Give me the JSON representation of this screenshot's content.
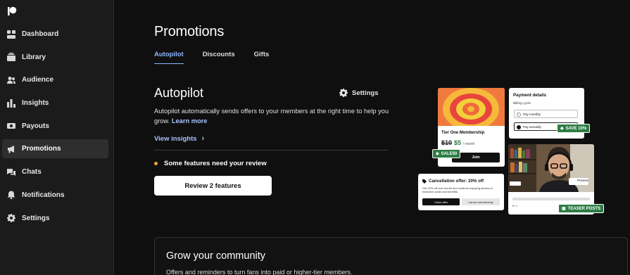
{
  "sidebar": {
    "logo_icon": "patreon-logo-icon",
    "items": [
      {
        "label": "Dashboard",
        "icon": "dashboard-icon"
      },
      {
        "label": "Library",
        "icon": "library-icon"
      },
      {
        "label": "Audience",
        "icon": "audience-icon"
      },
      {
        "label": "Insights",
        "icon": "insights-icon"
      },
      {
        "label": "Payouts",
        "icon": "payouts-icon"
      },
      {
        "label": "Promotions",
        "icon": "promotions-icon",
        "active": true
      },
      {
        "label": "Chats",
        "icon": "chats-icon"
      },
      {
        "label": "Notifications",
        "icon": "bell-icon"
      },
      {
        "label": "Settings",
        "icon": "gear-icon"
      }
    ]
  },
  "page": {
    "title": "Promotions",
    "tabs": [
      {
        "label": "Autopilot",
        "active": true
      },
      {
        "label": "Discounts"
      },
      {
        "label": "Gifts"
      }
    ]
  },
  "autopilot": {
    "title": "Autopilot",
    "settings_label": "Settings",
    "description": "Autopilot automatically sends offers to your members at the right time to help you grow.",
    "learn_more": "Learn more",
    "view_insights": "View insights",
    "alert": "Some features need your review",
    "review_button": "Review 2 features"
  },
  "illustration": {
    "tier_title": "Tier One Membership",
    "old_price": "$10",
    "new_price": "$5",
    "per": "/ month",
    "join": "Join",
    "sale_badge": "SALE50",
    "payment_title": "Payment details",
    "billing_cycle": "Billing cycle",
    "pay_monthly": "Pay monthly",
    "pay_annually": "Pay annually",
    "save_badge": "SAVE 10%",
    "cancel_title": "Cancellation offer: 20% off",
    "cancel_desc": "Get 20% off next month and continue enjoying access to exclusive posts and benefits.",
    "claim_offer": "Claim offer",
    "cancel_membership": "Cancel membership",
    "preview": "Preview",
    "teaser_badge": "TEASER POSTS"
  },
  "grow": {
    "title": "Grow your community",
    "subtitle": "Offers and reminders to turn fans into paid or higher-tier members."
  },
  "colors": {
    "accent": "#8fb7ff",
    "alert_dot": "#f0a43a",
    "badge_green": "#2d7d45",
    "sidebar_bg": "#1b1b1b",
    "page_bg": "#0f0f0f"
  }
}
